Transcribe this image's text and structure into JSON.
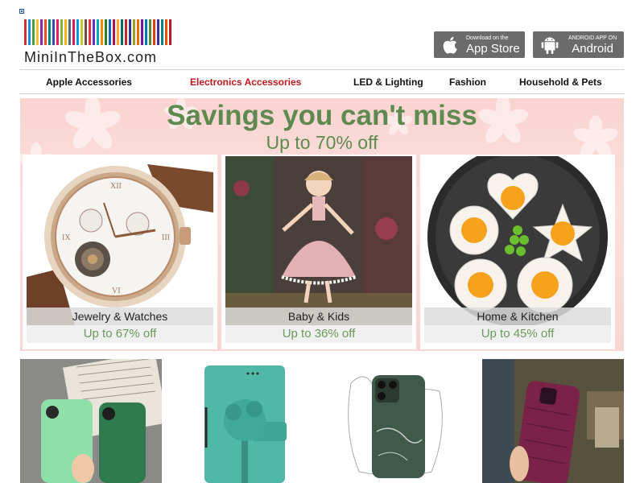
{
  "header": {
    "logo_text": "MiniInTheBox.com",
    "app_store": {
      "small": "Download on the",
      "big": "App Store",
      "icon": "apple-icon"
    },
    "android": {
      "small": "ANDROID APP ON",
      "big": "Android",
      "icon": "android-icon"
    }
  },
  "nav": {
    "items": [
      {
        "label": "Apple Accessories"
      },
      {
        "label": "Electronics Accessories",
        "active": true
      },
      {
        "label": "LED & Lighting"
      },
      {
        "label": "Fashion"
      },
      {
        "label": "Household & Pets"
      }
    ]
  },
  "banner": {
    "title": "Savings you can't miss",
    "subtitle": "Up to 70% off",
    "cards": [
      {
        "label": "Jewelry & Watches",
        "offer": "Up to 67% off"
      },
      {
        "label": "Baby & Kids",
        "offer": "Up to 36% off"
      },
      {
        "label": "Home & Kitchen",
        "offer": "Up to 45% off"
      }
    ]
  },
  "colors": {
    "accent_green": "#5e8a4f",
    "nav_active": "#c0171c",
    "store_button": "#6b6b6b",
    "banner_pink": "#f9d4d1"
  }
}
